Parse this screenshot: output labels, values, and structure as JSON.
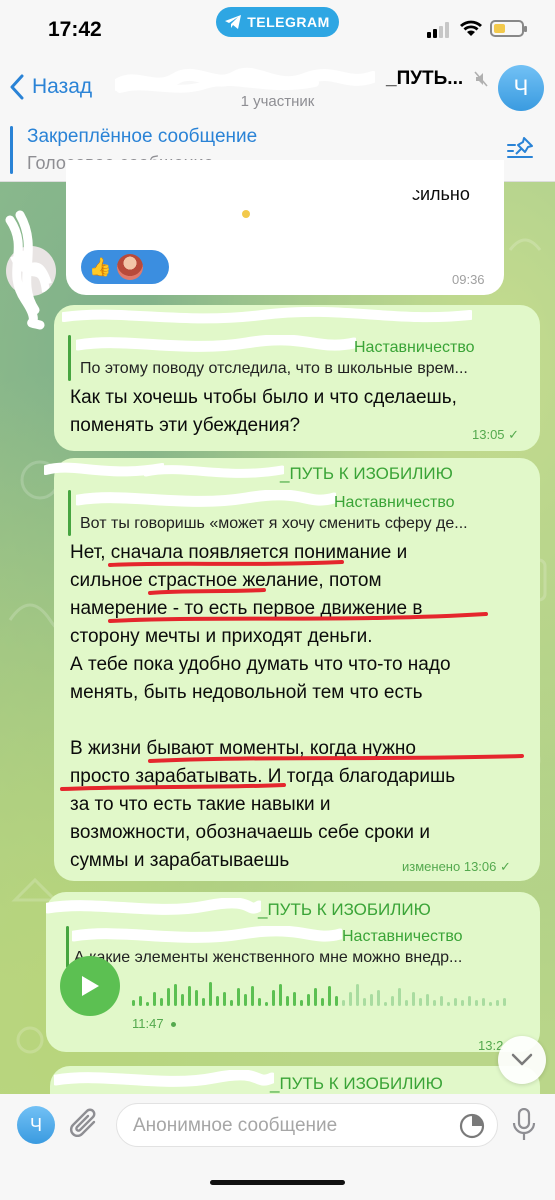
{
  "status_bar": {
    "time": "17:42",
    "badge": "TELEGRAM"
  },
  "header": {
    "back_label": "Назад",
    "title": "_ПУТЬ...",
    "subtitle": "1 участник",
    "avatar_letter": "Ч"
  },
  "pinned": {
    "title": "Закреплённое сообщение",
    "text": "Голосовое сообщение"
  },
  "messages": [
    {
      "kind": "incoming",
      "text_fragment": "сильно",
      "time": "09:36",
      "reactions": [
        "👍"
      ]
    },
    {
      "kind": "outgoing",
      "reply_title": "Наставничество",
      "reply_text": "По этому поводу отследила, что в школьные врем...",
      "lines": [
        "Как ты хочешь чтобы было и что сделаешь,",
        "поменять эти убеждения?"
      ],
      "time": "13:05"
    },
    {
      "kind": "outgoing",
      "sender": "_ПУТЬ К ИЗОБИЛИЮ",
      "reply_title": "Наставничество",
      "reply_text": "Вот ты говоришь «может я хочу сменить сферу де...",
      "lines": [
        "Нет, сначала появляется понимание и",
        "сильное страстное желание, потом",
        "намерение - то есть первое движение в",
        "сторону мечты и приходят деньги.",
        "А тебе пока удобно думать что что-то надо",
        "менять, быть недовольной тем что есть",
        "",
        "В жизни бывают моменты, когда нужно",
        "просто зарабатывать. И тогда благодаришь",
        "за то что есть такие навыки и",
        "возможности, обозначаешь себе сроки и",
        "суммы и зарабатываешь"
      ],
      "edited": "изменено",
      "time": "13:06"
    },
    {
      "kind": "outgoing",
      "sender": "_ПУТЬ К ИЗОБИЛИЮ",
      "reply_title": "Наставничество",
      "reply_text": "А какие элементы женственного мне можно внедр...",
      "voice_duration": "11:47",
      "time": "13:2"
    },
    {
      "kind": "outgoing",
      "sender": "_ПУТЬ К ИЗОБИЛИЮ"
    }
  ],
  "composer": {
    "placeholder": "Анонимное сообщение",
    "avatar_letter": "Ч"
  },
  "colors": {
    "accent": "#2a83d6",
    "sender_green": "#3aa437",
    "outgoing_bg": "#e1f8c9",
    "underline_red": "#e5262d"
  }
}
